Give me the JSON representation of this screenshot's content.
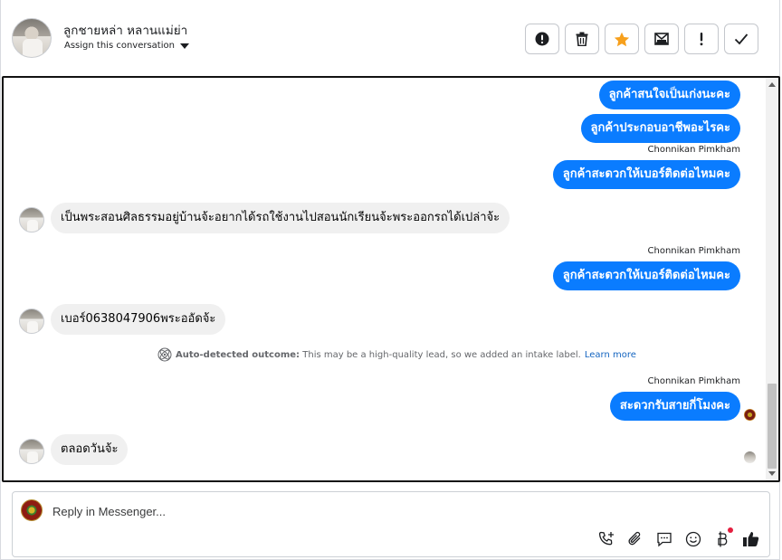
{
  "header": {
    "contact_name": "ลูกชายหล่า หลานแม่ย่า",
    "assign_label": "Assign this conversation",
    "actions": [
      {
        "name": "report-spam-button",
        "icon": "exclamation-circle-icon"
      },
      {
        "name": "delete-button",
        "icon": "trash-icon"
      },
      {
        "name": "star-button",
        "icon": "star-icon"
      },
      {
        "name": "mark-unread-button",
        "icon": "envelope-icon"
      },
      {
        "name": "important-button",
        "icon": "exclamation-icon"
      },
      {
        "name": "mark-done-button",
        "icon": "check-icon"
      }
    ],
    "star_color": "#f7a01c"
  },
  "conversation": {
    "messages": [
      {
        "dir": "out",
        "text": "ลูกค้าสนใจเป็นเก่งนะคะ"
      },
      {
        "dir": "out",
        "text": "ลูกค้าประกอบอาชีพอะไรคะ"
      },
      {
        "dir": "out",
        "sender": "Chonnikan Pimkham",
        "text": "ลูกค้าสะดวกให้เบอร์ติดต่อไหมคะ"
      },
      {
        "dir": "in",
        "text": "เป็นพระสอนศิลธรรมอยู่บ้านจ้ะอยากได้รถใช้งานไปสอนนักเรียนจ้ะพระออกรถได้เปล่าจ้ะ"
      },
      {
        "dir": "out",
        "sender": "Chonnikan Pimkham",
        "text": "ลูกค้าสะดวกให้เบอร์ติดต่อไหมคะ"
      },
      {
        "dir": "in",
        "text": "เบอร์0638047906พระออัดจ้ะ"
      },
      {
        "dir": "out",
        "sender": "Chonnikan Pimkham",
        "text": "สะดวกรับสายกี่โมงคะ"
      },
      {
        "dir": "in",
        "text": "ตลอดวันจ้ะ"
      }
    ],
    "outcome": {
      "bold": "Auto-detected outcome:",
      "text": " This may be a high-quality lead, so we added an intake label.",
      "link": "Learn more"
    }
  },
  "composer": {
    "placeholder": "Reply in Messenger...",
    "tools": [
      "phone-plus-icon",
      "paperclip-icon",
      "chat-bubble-icon",
      "smiley-icon",
      "baht-icon",
      "thumbs-up-icon"
    ]
  },
  "colors": {
    "outgoing_bubble": "#0a7cff",
    "incoming_bubble": "#f0f0f0"
  }
}
